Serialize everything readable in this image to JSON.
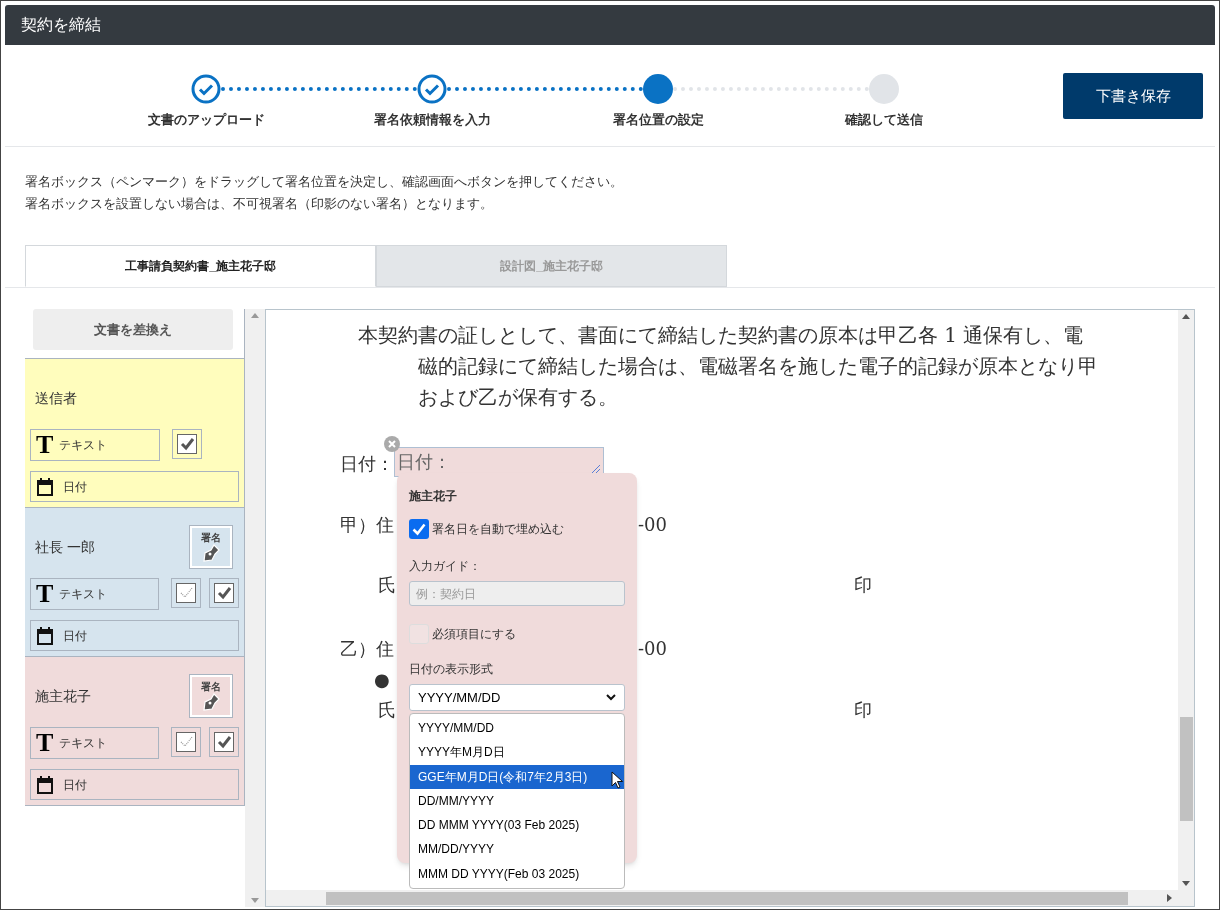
{
  "header": {
    "title": "契約を締結"
  },
  "steps": [
    {
      "label": "文書のアップロード",
      "kind": "completed"
    },
    {
      "label": "署名依頼情報を入力",
      "kind": "completed"
    },
    {
      "label": "署名位置の設定",
      "kind": "current"
    },
    {
      "label": "確認して送信",
      "kind": "pending"
    }
  ],
  "save_button": "下書き保存",
  "instructions": [
    "署名ボックス（ペンマーク）をドラッグして署名位置を決定し、確認画面へボタンを押してください。",
    "署名ボックスを設置しない場合は、不可視署名（印影のない署名）となります。"
  ],
  "doc_tabs": [
    {
      "label": "工事請負契約書_施主花子邸",
      "selected": true
    },
    {
      "label": "設計図_施主花子邸",
      "selected": false
    }
  ],
  "sidebar": {
    "replace_button": "文書を差換え",
    "signers": [
      {
        "name": "送信者",
        "color": "#fffdbd",
        "tools": [
          {
            "kind": "text",
            "icon": "T",
            "label": "テキスト"
          },
          {
            "kind": "check_bold"
          },
          {
            "kind": "date",
            "label": "日付"
          }
        ]
      },
      {
        "name": "社長 一郎",
        "color": "#d6e4ee",
        "signature": "署名",
        "tools": [
          {
            "kind": "text",
            "icon": "T",
            "label": "テキスト"
          },
          {
            "kind": "check_light"
          },
          {
            "kind": "check_bold"
          },
          {
            "kind": "date",
            "label": "日付"
          }
        ]
      },
      {
        "name": "施主花子",
        "color": "#f0dbdb",
        "signature": "署名",
        "tools": [
          {
            "kind": "text",
            "icon": "T",
            "label": "テキスト"
          },
          {
            "kind": "check_light"
          },
          {
            "kind": "check_bold"
          },
          {
            "kind": "date",
            "label": "日付"
          }
        ]
      }
    ]
  },
  "document": {
    "paragraph": "本契約書の証しとして、書面にて締結した契約書の原本は甲乙各 1 通保有し、電磁的記録にて締結した場合は、電磁署名を施した電子的記録が原本となり甲および乙が保有する。",
    "date_label": "日付：",
    "date_field": "日付：",
    "party_a_address": "甲）住",
    "party_a_address_end": "-00",
    "party_a_name": "氏",
    "seal_a": "印",
    "party_b_address": "乙）住",
    "party_b_address_end": "-00",
    "party_b_company": "●",
    "party_b_name": "氏",
    "seal_b": "印"
  },
  "popup": {
    "title": "施主花子",
    "auto_date": {
      "label": "署名日を自動で埋め込む",
      "checked": true
    },
    "guide_label": "入力ガイド：",
    "guide_placeholder": "例：契約日",
    "required": {
      "label": "必須項目にする",
      "checked": false
    },
    "format_label": "日付の表示形式",
    "format_value": "YYYY/MM/DD",
    "options": [
      {
        "label": "YYYY/MM/DD",
        "selected": false
      },
      {
        "label": "YYYY年M月D日",
        "selected": false
      },
      {
        "label": "GGE年M月D日(令和7年2月3日)",
        "selected": true
      },
      {
        "label": "DD/MM/YYYY",
        "selected": false
      },
      {
        "label": "DD MMM YYYY(03 Feb 2025)",
        "selected": false
      },
      {
        "label": "MM/DD/YYYY",
        "selected": false
      },
      {
        "label": "MMM DD YYYY(Feb 03 2025)",
        "selected": false
      }
    ]
  }
}
